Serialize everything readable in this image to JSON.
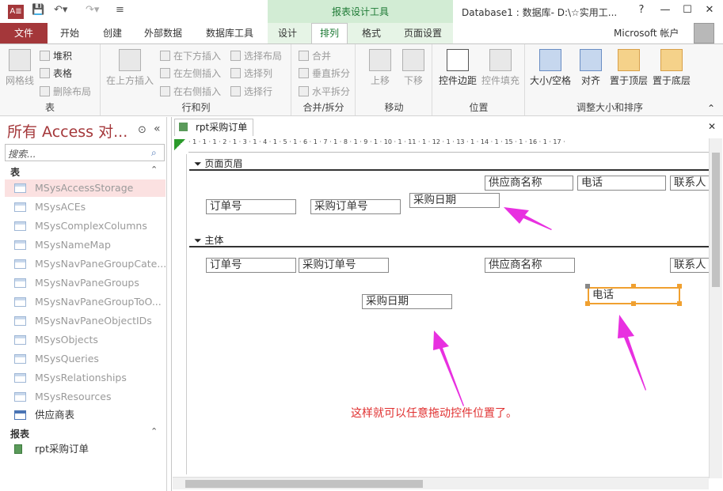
{
  "titlebar": {
    "context_group": "报表设计工具",
    "window_title": "Database1 : 数据库- D:\\☆实用工...",
    "help": "?",
    "minimize": "—",
    "maximize": "☐",
    "close": "✕"
  },
  "menu": {
    "file": "文件",
    "tabs": [
      "开始",
      "创建",
      "外部数据",
      "数据库工具",
      "设计",
      "排列",
      "格式",
      "页面设置"
    ],
    "account": "Microsoft 帐户"
  },
  "ribbon": {
    "groups": {
      "table": {
        "label": "表",
        "gridlines": "网格线",
        "stacked": "堆积",
        "tabular": "表格",
        "remove_layout": "删除布局"
      },
      "rows_cols": {
        "label": "行和列",
        "insert_above": "在上方插入",
        "insert_below": "在下方插入",
        "insert_left": "在左侧插入",
        "insert_right": "在右侧插入",
        "select_layout": "选择布局",
        "select_column": "选择列",
        "select_row": "选择行"
      },
      "merge_split": {
        "label": "合并/拆分",
        "merge": "合并",
        "split_vert": "垂直拆分",
        "split_horz": "水平拆分"
      },
      "move": {
        "label": "移动",
        "up": "上移",
        "down": "下移"
      },
      "position": {
        "label": "位置",
        "margins": "控件边距",
        "padding": "控件填充"
      },
      "size_order": {
        "label": "调整大小和排序",
        "size_space": "大小/空格",
        "align": "对齐",
        "bring_front": "置于顶层",
        "send_back": "置于底层"
      }
    }
  },
  "nav": {
    "title": "所有 Access 对...",
    "search_placeholder": "搜索...",
    "sections": {
      "tables": "表",
      "reports": "报表"
    },
    "tables": [
      "MSysAccessStorage",
      "MSysACEs",
      "MSysComplexColumns",
      "MSysNameMap",
      "MSysNavPaneGroupCate...",
      "MSysNavPaneGroups",
      "MSysNavPaneGroupToO...",
      "MSysNavPaneObjectIDs",
      "MSysObjects",
      "MSysQueries",
      "MSysRelationships",
      "MSysResources",
      "供应商表"
    ],
    "reports": [
      "rpt采购订单"
    ]
  },
  "document": {
    "tab": "rpt采购订单",
    "close": "✕",
    "ruler": "· 1 · 1 · 1 · 2 · 1 · 3 · 1 · 4 · 1 · 5 · 1 · 6 · 1 · 7 · 1 · 8 · 1 · 9 · 1 · 10 · 1 · 11 · 1 · 12 · 1 · 13 · 1 · 14 · 1 · 15 · 1 · 16 · 1 · 17 ·",
    "page_header": "页面页眉",
    "detail": "主体",
    "header_labels": {
      "order_id": "订单号",
      "po_number": "采购订单号",
      "po_date": "采购日期",
      "supplier": "供应商名称",
      "phone": "电话",
      "contact": "联系人"
    },
    "detail_fields": {
      "order_id": "订单号",
      "po_number": "采购订单号",
      "po_date": "采购日期",
      "supplier": "供应商名称",
      "phone": "电话",
      "contact": "联系人"
    },
    "annotation": "这样就可以任意拖动控件位置了。"
  },
  "colors": {
    "file_tab": "#a4373a",
    "context_green": "#1e7a35",
    "annotation_arrow": "#e830e0",
    "selection": "#f0a030"
  }
}
